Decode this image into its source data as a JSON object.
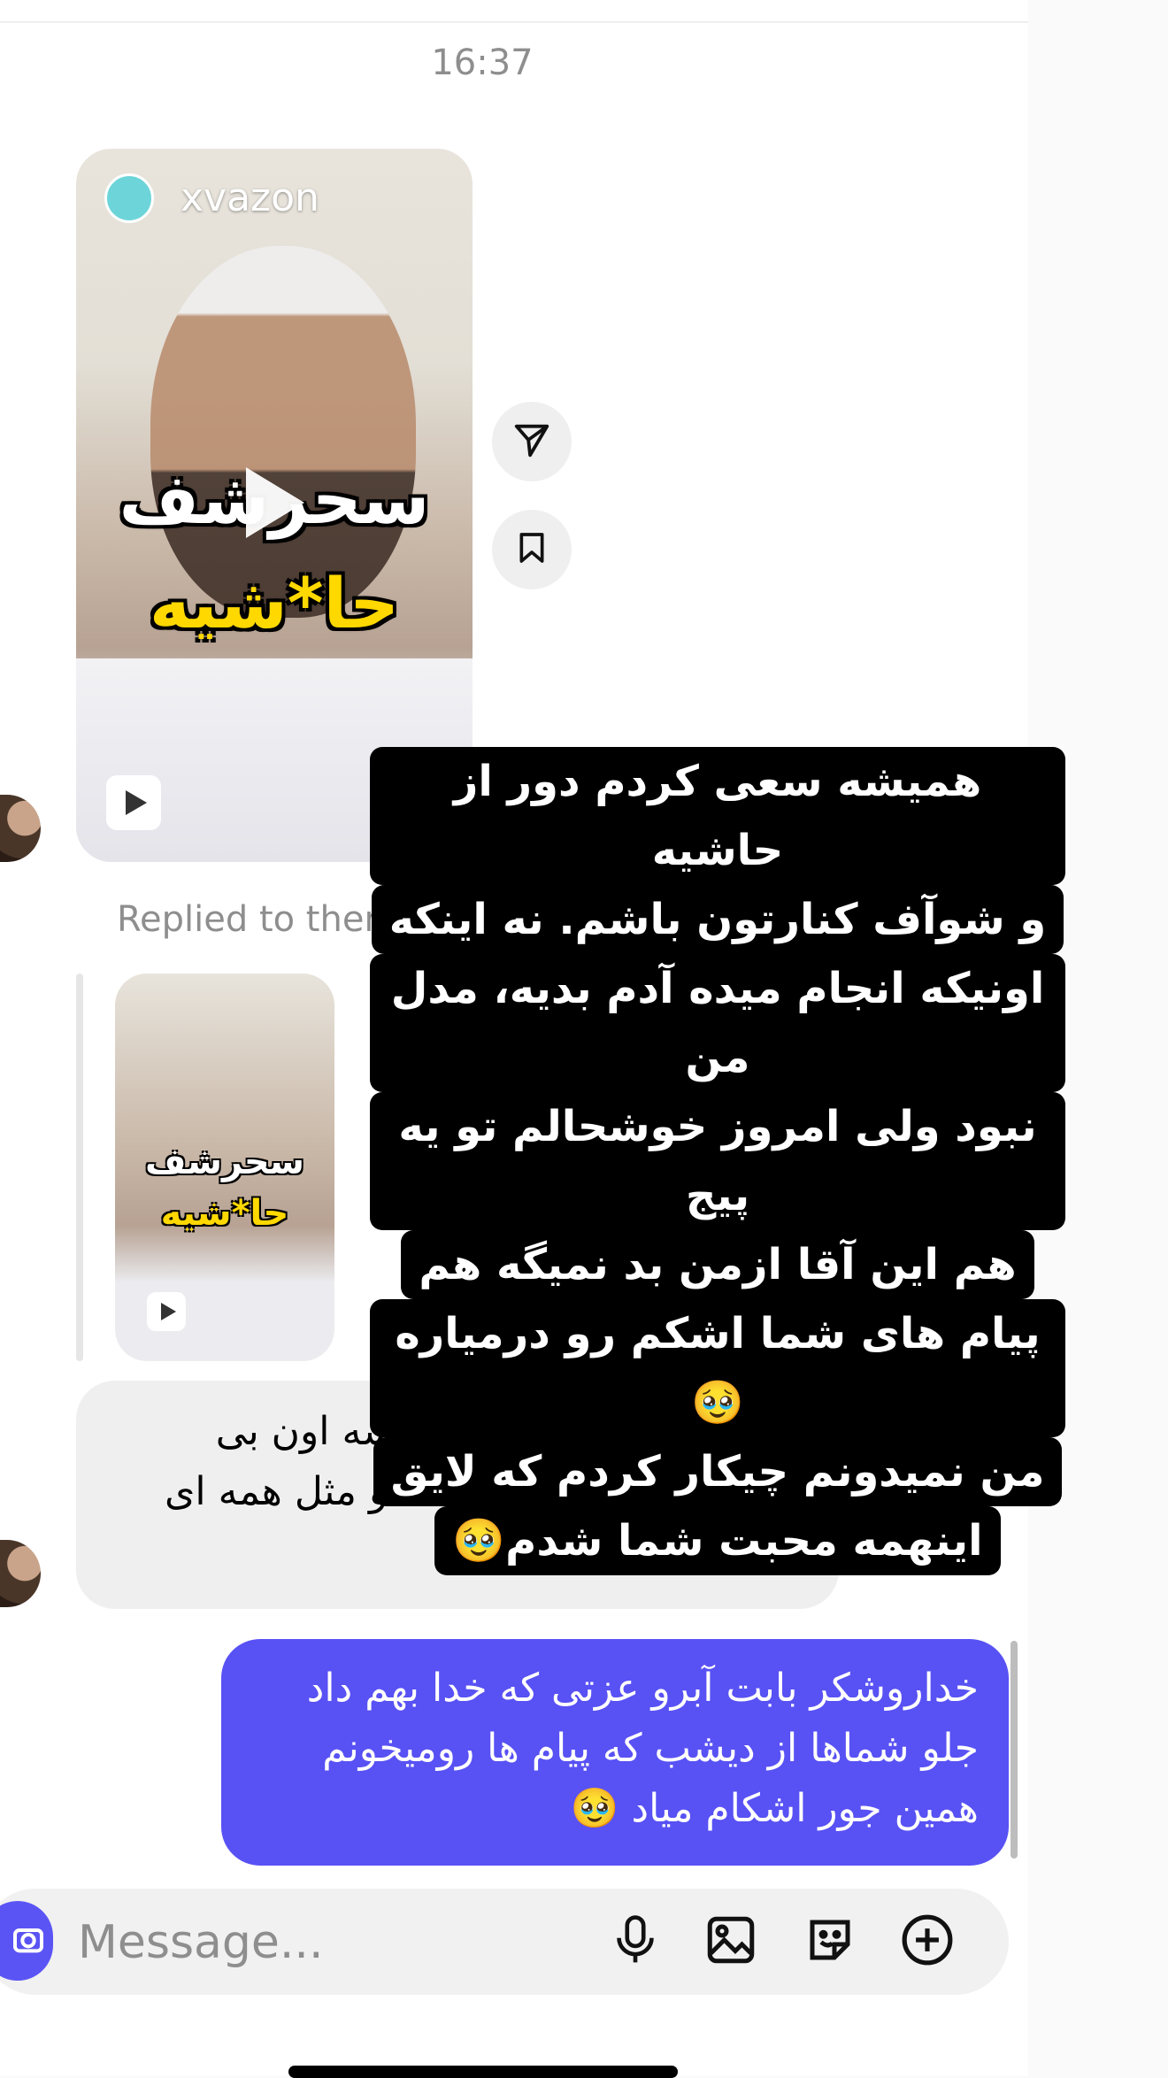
{
  "timestamp": "16:37",
  "shared_reel": {
    "username": "xvazon",
    "overlay_line1": "سحرشف",
    "overlay_line2": "حا*شیه"
  },
  "reel_actions": {
    "share_icon": "paper-plane-icon",
    "save_icon": "bookmark-icon"
  },
  "reel_caption_lines": [
    "همیشه سعی کردم دور از حاشیه",
    "و شوآف کنارتون باشم. نه اینکه",
    "اونیکه انجام میده آدم بدیه، مدل من",
    "نبود ولی امروز خوشحالم تو یه پیج",
    "هم این آقا ازمن بد نمیگه هم",
    "پیام های شما اشکم رو درمیاره🥹",
    "من نمیدونم چیکار کردم که لایق",
    "اینهمه محبت شما شدم🥹"
  ],
  "reply": {
    "label": "Replied to ther",
    "reel_line1": "سحرشف",
    "reel_line2": "حا*شیه"
  },
  "incoming_message": "سحر جون اینم بفرست واسه اون بی شخصیت که فکر می کنه تو مثل همه ای",
  "outgoing_message": "خداروشکر بابت  آبرو عزتی که خدا بهم داد جلو شماها از دیشب که پیام ها رومیخونم همین جور اشکام میاد 🥹",
  "composer": {
    "placeholder": "Message...",
    "value": "",
    "icons": [
      "camera-icon",
      "microphone-icon",
      "gallery-icon",
      "sticker-icon",
      "plus-icon"
    ]
  },
  "colors": {
    "outgoing_bubble": "#5851f4",
    "incoming_bubble": "#efefef",
    "caption_bg": "#000000"
  }
}
